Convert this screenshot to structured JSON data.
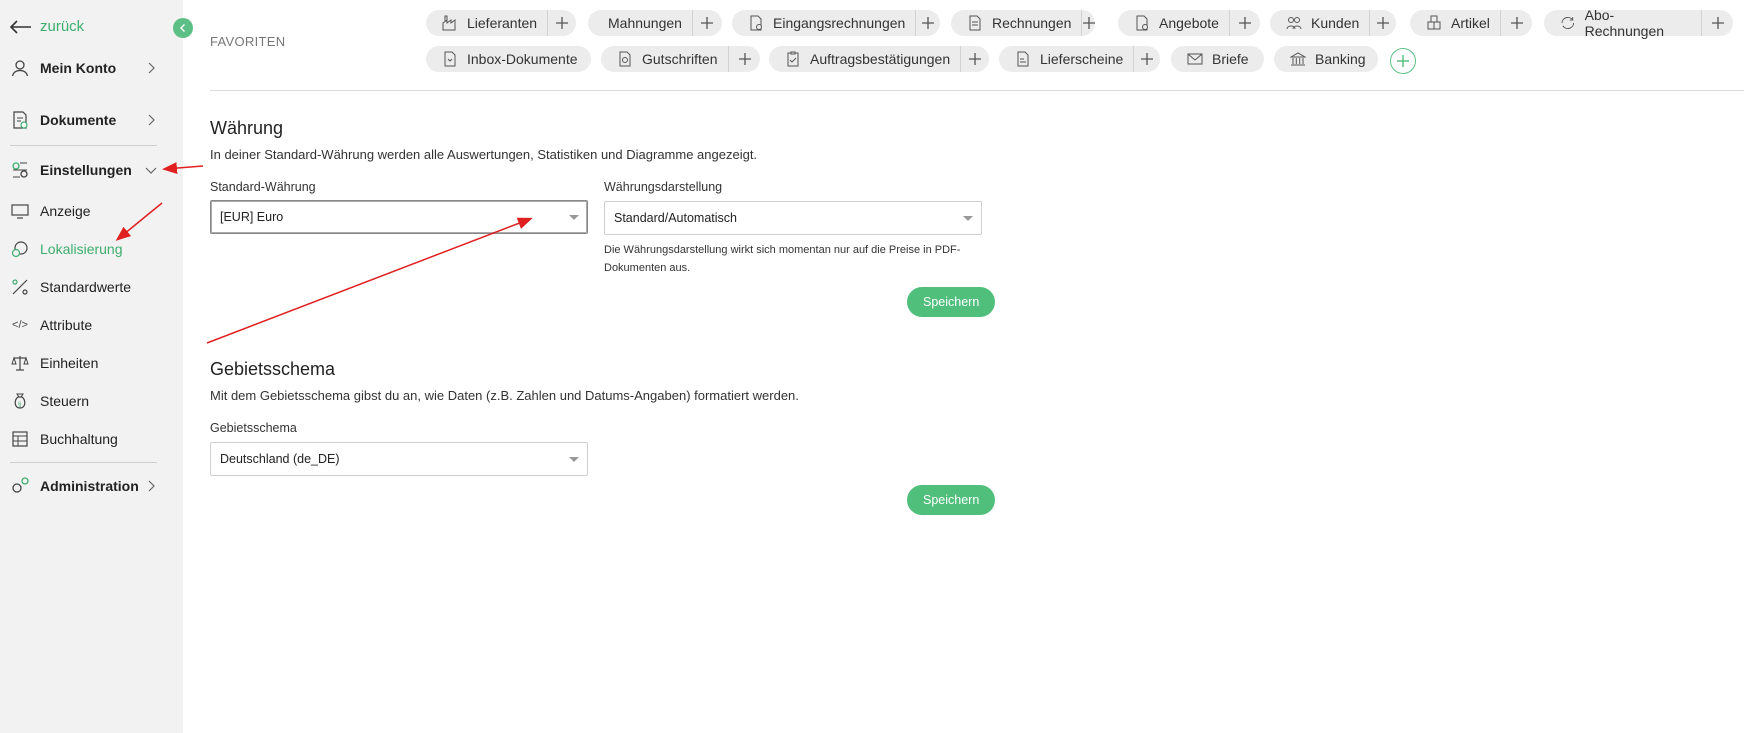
{
  "sidebar": {
    "back_label": "zurück",
    "items": [
      {
        "label": "Mein Konto"
      },
      {
        "label": "Dokumente"
      },
      {
        "label": "Einstellungen"
      },
      {
        "label": "Anzeige"
      },
      {
        "label": "Lokalisierung"
      },
      {
        "label": "Standardwerte"
      },
      {
        "label": "Attribute"
      },
      {
        "label": "Einheiten"
      },
      {
        "label": "Steuern"
      },
      {
        "label": "Buchhaltung"
      },
      {
        "label": "Administration"
      }
    ]
  },
  "favorites": {
    "title": "FAVORITEN",
    "row1": [
      {
        "label": "Lieferanten"
      },
      {
        "label": "Mahnungen"
      },
      {
        "label": "Eingangsrechnungen"
      },
      {
        "label": "Rechnungen"
      },
      {
        "label": "Angebote"
      },
      {
        "label": "Kunden"
      },
      {
        "label": "Artikel"
      },
      {
        "label": "Abo-Rechnungen"
      }
    ],
    "row2": [
      {
        "label": "Inbox-Dokumente"
      },
      {
        "label": "Gutschriften"
      },
      {
        "label": "Auftragsbestätigungen"
      },
      {
        "label": "Lieferscheine"
      },
      {
        "label": "Briefe"
      },
      {
        "label": "Banking"
      }
    ]
  },
  "currency": {
    "heading": "Währung",
    "description": "In deiner Standard-Währung werden alle Auswertungen, Statistiken und Diagramme angezeigt.",
    "default_label": "Standard-Währung",
    "default_value": "[EUR] Euro",
    "display_label": "Währungsdarstellung",
    "display_value": "Standard/Automatisch",
    "hint": "Die Währungsdarstellung wirkt sich momentan nur auf die Preise in PDF-Dokumenten aus.",
    "save_label": "Speichern"
  },
  "locale": {
    "heading": "Gebietsschema",
    "description": "Mit dem Gebietsschema gibst du an, wie Daten (z.B. Zahlen und Datums-Angaben) formatiert werden.",
    "field_label": "Gebietsschema",
    "field_value": "Deutschland (de_DE)",
    "save_label": "Speichern"
  },
  "colors": {
    "accent": "#3dae6e",
    "button": "#4fbf7b",
    "annotation": "#e02020"
  }
}
